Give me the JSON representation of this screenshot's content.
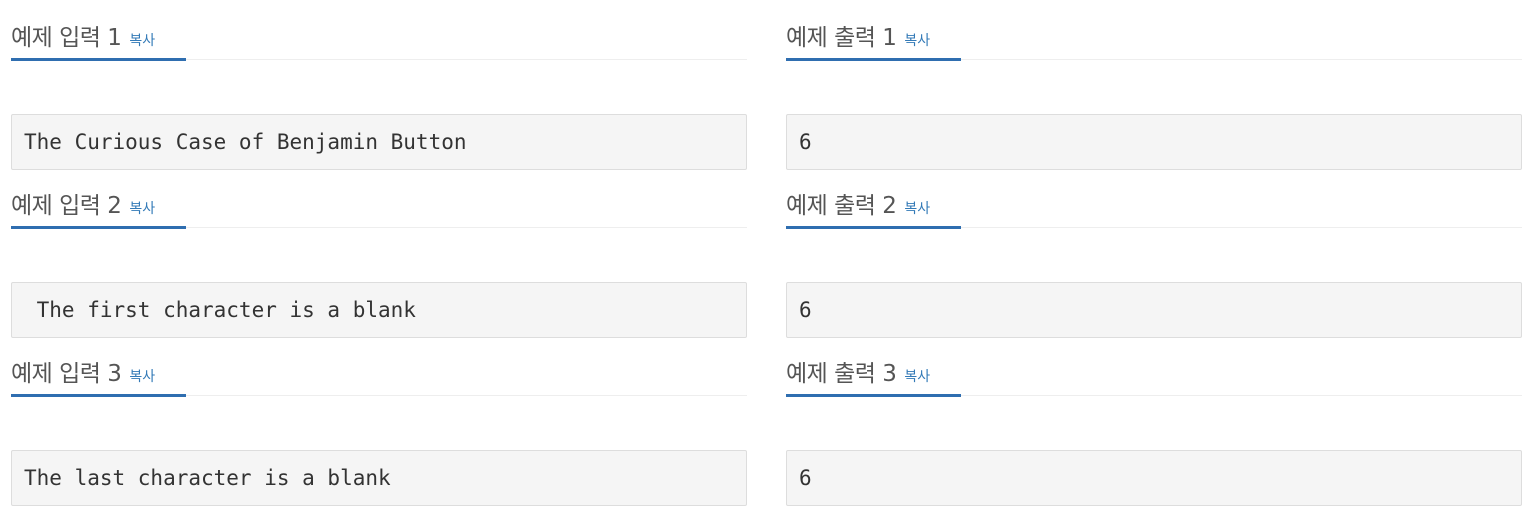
{
  "copy_label": "복사",
  "inputs": [
    {
      "title": "예제 입력 1",
      "text": "The Curious Case of Benjamin Button"
    },
    {
      "title": "예제 입력 2",
      "text": " The first character is a blank"
    },
    {
      "title": "예제 입력 3",
      "text": "The last character is a blank "
    }
  ],
  "outputs": [
    {
      "title": "예제 출력 1",
      "text": "6"
    },
    {
      "title": "예제 출력 2",
      "text": "6"
    },
    {
      "title": "예제 출력 3",
      "text": "6"
    }
  ],
  "colors": {
    "accent": "#2f6eb0",
    "link": "#337ab7",
    "sample_bg": "#f5f5f5"
  }
}
